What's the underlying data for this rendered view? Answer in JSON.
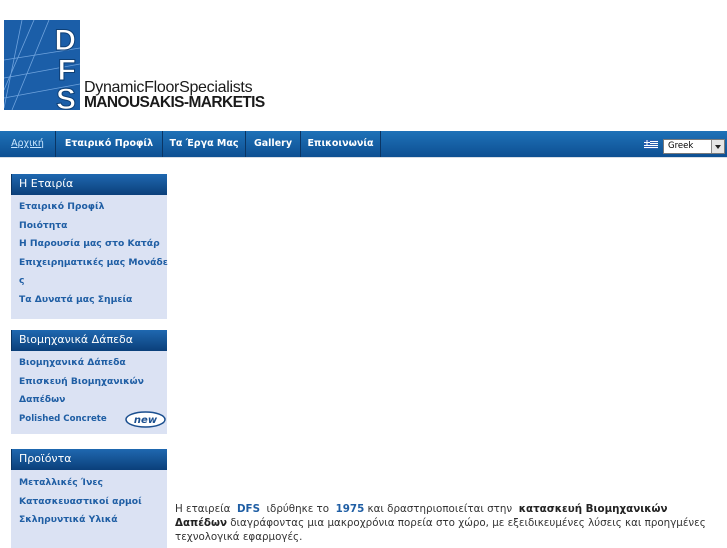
{
  "logo": {
    "letters": "DFS",
    "line1": "DynamicFloorSpecialists",
    "line2": "MANOUSAKIS-MARKETIS"
  },
  "nav": {
    "items": [
      {
        "label": "Αρχική",
        "active": true
      },
      {
        "label": "Εταιρικό Προφίλ"
      },
      {
        "label": "Τα Έργα Μας"
      },
      {
        "label": "Gallery"
      },
      {
        "label": "Επικοινωνία"
      }
    ],
    "language": "Greek"
  },
  "sidebar": {
    "company": {
      "title": "Η Εταιρία",
      "links": [
        "Εταιρικό Προφίλ",
        "Ποιότητα",
        "Η Παρουσία μας στο Κατάρ",
        "Επιχειρηματικές μας Μονάδε",
        "ς",
        "Τα Δυνατά μας Σημεία"
      ]
    },
    "floors": {
      "title": "Βιομηχανικά Δάπεδα",
      "links": [
        "Βιομηχανικά Δάπεδα",
        "Επισκευή Βιομηχανικών",
        "Δαπέδων",
        "Polished Concrete"
      ],
      "badge": "new"
    },
    "products": {
      "title": "Προϊόντα",
      "links": [
        "Μεταλλικές Ίνες",
        "Κατασκευαστικοί αρμοί",
        "Σκληρυντικά Υλικά"
      ]
    }
  },
  "main": {
    "p1": "Η εταιρεία",
    "p2": "DFS",
    "p3": "ιδρύθηκε το",
    "p4": "1975",
    "p5": "και δραστηριοποιείται στην",
    "p6": "κατασκευή Βιομηχανικών Δαπέδων",
    "p7": "διαγράφοντας μια μακροχρόνια πορεία στο χώρο, με εξειδικευμένες λύσεις και προηγμένες τεχνολογικά εφαρμογές."
  },
  "colors": {
    "nav_bg": "#1565ad",
    "sidebar_bg": "#dbe2f3",
    "link": "#1f5ea4",
    "logo_blue": "#1b5ea8"
  }
}
